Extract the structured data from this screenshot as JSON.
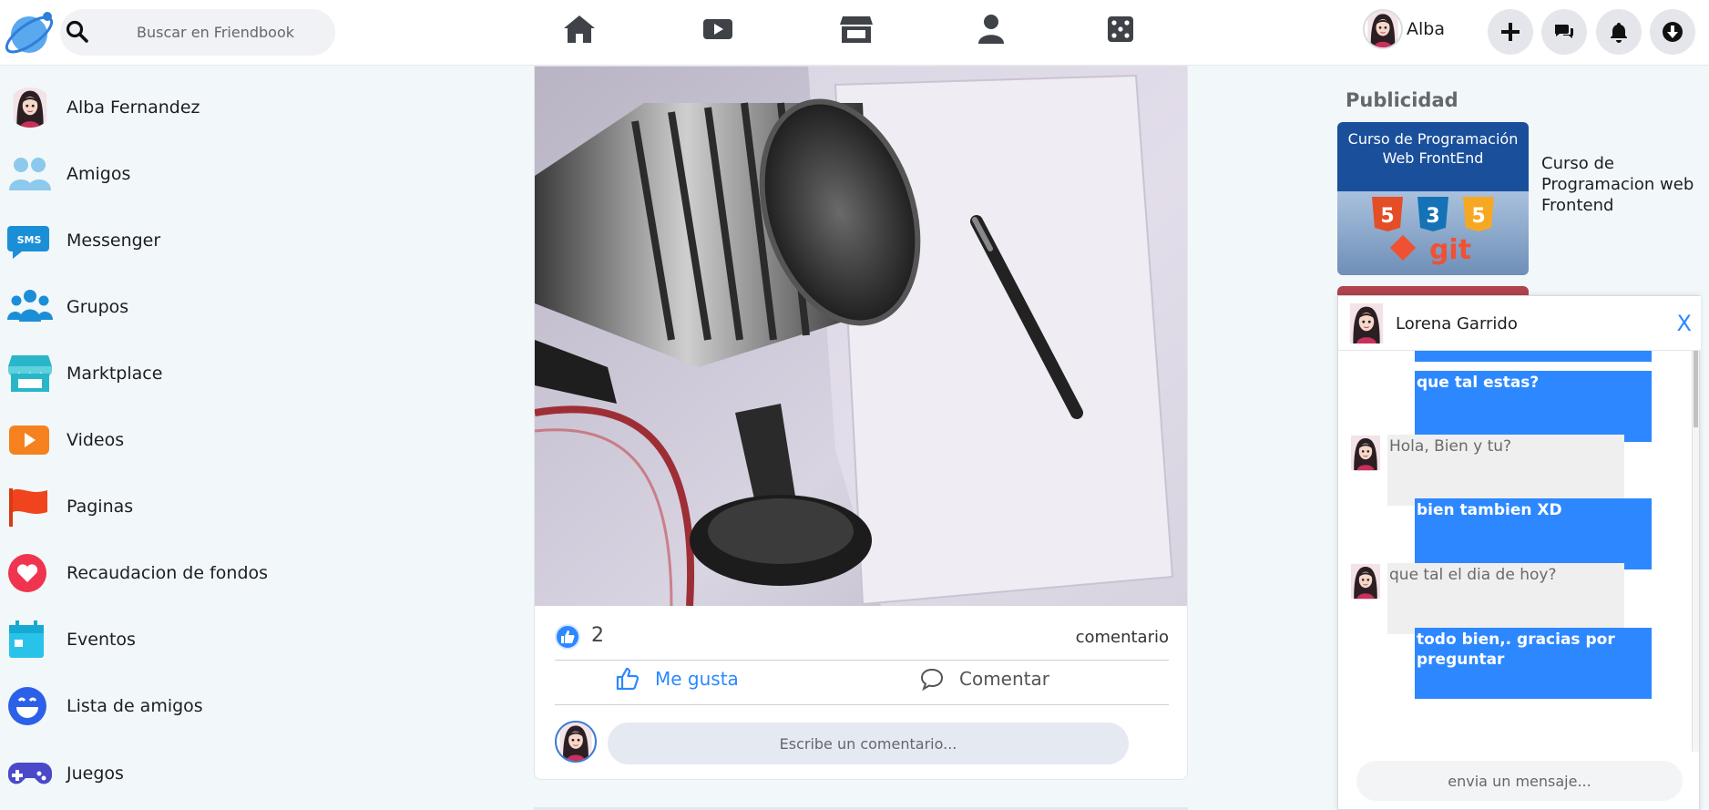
{
  "header": {
    "search_placeholder": "Buscar en Friendbook",
    "nav": [
      "home-icon",
      "video-icon",
      "marketplace-icon",
      "profile-icon",
      "games-icon"
    ],
    "user_name": "Alba",
    "actions": [
      "plus-icon",
      "chat-icon",
      "bell-icon",
      "download-icon"
    ]
  },
  "sidebar": {
    "items": [
      {
        "label": "Alba Fernandez",
        "icon": "avatar"
      },
      {
        "label": "Amigos",
        "icon": "friends-icon",
        "color": "#7ec3e8"
      },
      {
        "label": "Messenger",
        "icon": "sms-icon",
        "color": "#1a8fd8"
      },
      {
        "label": "Grupos",
        "icon": "groups-icon",
        "color": "#1a8fd8"
      },
      {
        "label": "Marktplace",
        "icon": "store-icon",
        "color": "#29b6c9"
      },
      {
        "label": "Videos",
        "icon": "play-icon",
        "color": "#f5821f"
      },
      {
        "label": "Paginas",
        "icon": "flag-icon",
        "color": "#f0441f"
      },
      {
        "label": "Recaudacion de fondos",
        "icon": "heart-icon",
        "color": "#f0344f"
      },
      {
        "label": "Eventos",
        "icon": "calendar-icon",
        "color": "#29c3ea"
      },
      {
        "label": "Lista de amigos",
        "icon": "smile-icon",
        "color": "#2d60e8"
      },
      {
        "label": "Juegos",
        "icon": "gamepad-icon",
        "color": "#4a49c9"
      }
    ]
  },
  "post": {
    "likes": "2",
    "comments_label": "comentario",
    "like_button": "Me gusta",
    "comment_button": "Comentar",
    "comment_placeholder": "Escribe un comentario..."
  },
  "ads": {
    "title": "Publicidad",
    "card_title": "Curso de Programación Web FrontEnd",
    "card_text": "Curso de Programacion web Frontend",
    "git_text": "git"
  },
  "chat": {
    "contact": "Lorena Garrido",
    "close": "X",
    "messages": [
      {
        "from": "me",
        "text": "que tal estas?"
      },
      {
        "from": "other",
        "text": "Hola, Bien y tu?"
      },
      {
        "from": "me",
        "text": "bien tambien XD"
      },
      {
        "from": "other",
        "text": "que tal el dia de hoy?"
      },
      {
        "from": "me",
        "text": "todo bien,. gracias por preguntar"
      }
    ],
    "input_placeholder": "envia un mensaje..."
  },
  "colors": {
    "accent": "#2d88ff",
    "background": "#f2f7f9"
  }
}
